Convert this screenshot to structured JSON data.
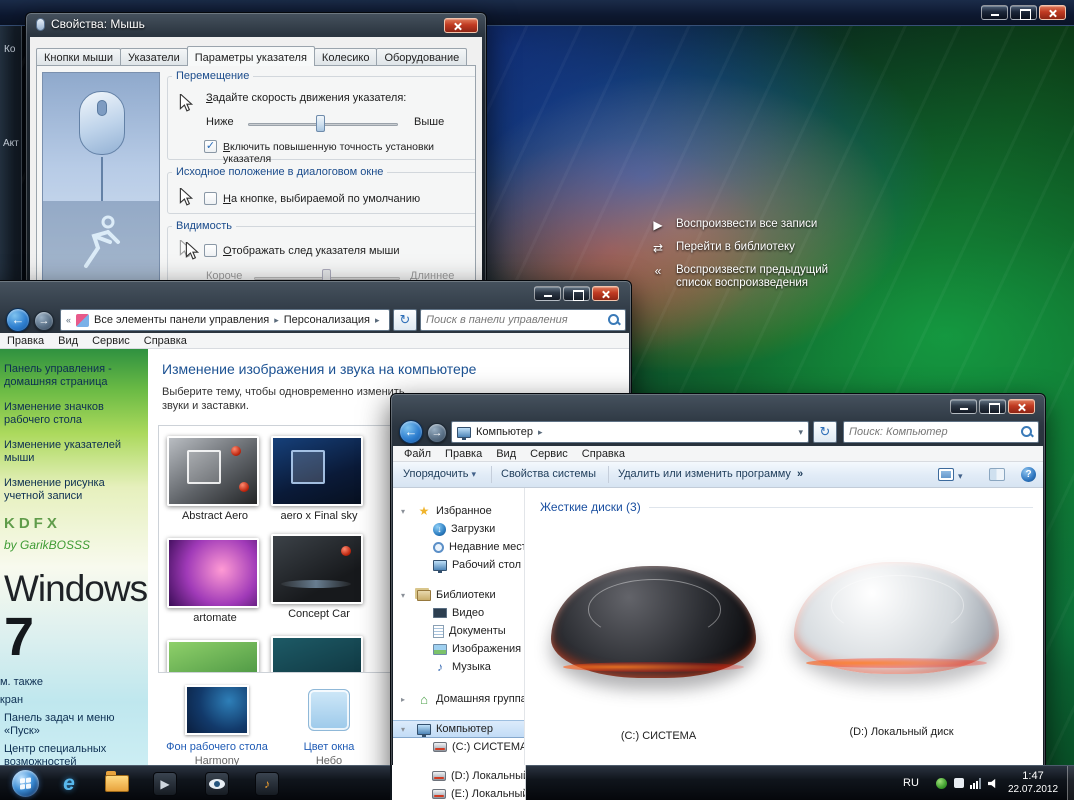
{
  "icons": {
    "close": "×",
    "back": "←",
    "forward": "→",
    "refresh": "↻",
    "dropdown": "▾",
    "crumb_sep": "▸",
    "crumb_overflow": "«",
    "star": "★",
    "music_note": "♪",
    "house": "⌂",
    "check": "✓",
    "expand_open": "▾",
    "expand_closed": "▸",
    "help": "?",
    "play": "▶",
    "library_arrows": "⇄",
    "previous_chevrons": "«",
    "download_arrow": "↓",
    "ie_letter": "e"
  },
  "background_window": {
    "fragment_top": "Ко",
    "fragment_mid": "Акт"
  },
  "desktop_menu": {
    "items": [
      {
        "label": "Воспроизвести все записи"
      },
      {
        "label": "Перейти в библиотеку"
      },
      {
        "label": "Воспроизвести предыдущий список воспроизведения"
      }
    ]
  },
  "mouse_dialog": {
    "title": "Свойства: Мышь",
    "tabs": [
      {
        "label": "Кнопки мыши"
      },
      {
        "label": "Указатели"
      },
      {
        "label": "Параметры указателя"
      },
      {
        "label": "Колесико"
      },
      {
        "label": "Оборудование"
      }
    ],
    "motion": {
      "title": "Перемещение",
      "label": "Задайте скорость движения указателя:",
      "slow": "Ниже",
      "fast": "Выше",
      "precision": "Включить повышенную точность установки указателя"
    },
    "snap": {
      "title": "Исходное положение в диалоговом окне",
      "checkbox": "На кнопке, выбираемой по умолчанию"
    },
    "visibility": {
      "title": "Видимость",
      "trail": "Отображать след указателя мыши",
      "short": "Короче",
      "long": "Длиннее"
    }
  },
  "personalization": {
    "breadcrumb": {
      "root": "Все элементы панели управления",
      "current": "Персонализация"
    },
    "search_placeholder": "Поиск в панели управления",
    "menu": [
      "Правка",
      "Вид",
      "Сервис",
      "Справка"
    ],
    "sidebar": {
      "links": [
        "Панель управления - домашняя страница",
        "Изменение значков рабочего стола",
        "Изменение указателей мыши",
        "Изменение рисунка учетной записи"
      ],
      "brand": "KDFX",
      "brand_by": "by GarikBOSSS",
      "brand_windows": "Windows",
      "brand_seven": "7",
      "see_also": [
        "См. также",
        "Экран",
        "Панель задач и меню «Пуск»",
        "Центр специальных возможностей"
      ]
    },
    "heading": "Изменение изображения и звука на компьютере",
    "subtext": [
      "Выберите тему, чтобы одновременно изменить",
      "звуки и заставки."
    ],
    "themes": [
      {
        "name": "Abstract Aero"
      },
      {
        "name": "aero x Final sky"
      },
      {
        "name": "artomate"
      },
      {
        "name": "Concept Car"
      }
    ],
    "bottom_items": [
      {
        "label": "Фон рабочего стола",
        "value": "Harmony"
      },
      {
        "label": "Цвет окна",
        "value": "Небо"
      }
    ]
  },
  "computer": {
    "breadcrumb": {
      "current": "Компьютер"
    },
    "search_placeholder": "Поиск: Компьютер",
    "menu": [
      "Файл",
      "Правка",
      "Вид",
      "Сервис",
      "Справка"
    ],
    "toolbar": {
      "organize": "Упорядочить",
      "system_props": "Свойства системы",
      "uninstall": "Удалить или изменить программу",
      "overflow": "»"
    },
    "nav": [
      {
        "label": "Избранное"
      },
      {
        "label": "Загрузки"
      },
      {
        "label": "Недавние места"
      },
      {
        "label": "Рабочий стол"
      },
      {
        "label": "Библиотеки"
      },
      {
        "label": "Видео"
      },
      {
        "label": "Документы"
      },
      {
        "label": "Изображения"
      },
      {
        "label": "Музыка"
      },
      {
        "label": "Домашняя группа"
      },
      {
        "label": "Компьютер"
      },
      {
        "label": "(C:) СИСТЕМА"
      },
      {
        "label": "(D:) Локальный диск"
      },
      {
        "label": "(E:) Локальный диск"
      }
    ],
    "group_header": "Жесткие диски (3)",
    "drives": [
      {
        "label": "(C:) СИСТЕМА"
      },
      {
        "label": "(D:) Локальный диск"
      }
    ]
  },
  "taskbar": {
    "lang": "RU",
    "time": "1:47",
    "date": "22.07.2012"
  }
}
